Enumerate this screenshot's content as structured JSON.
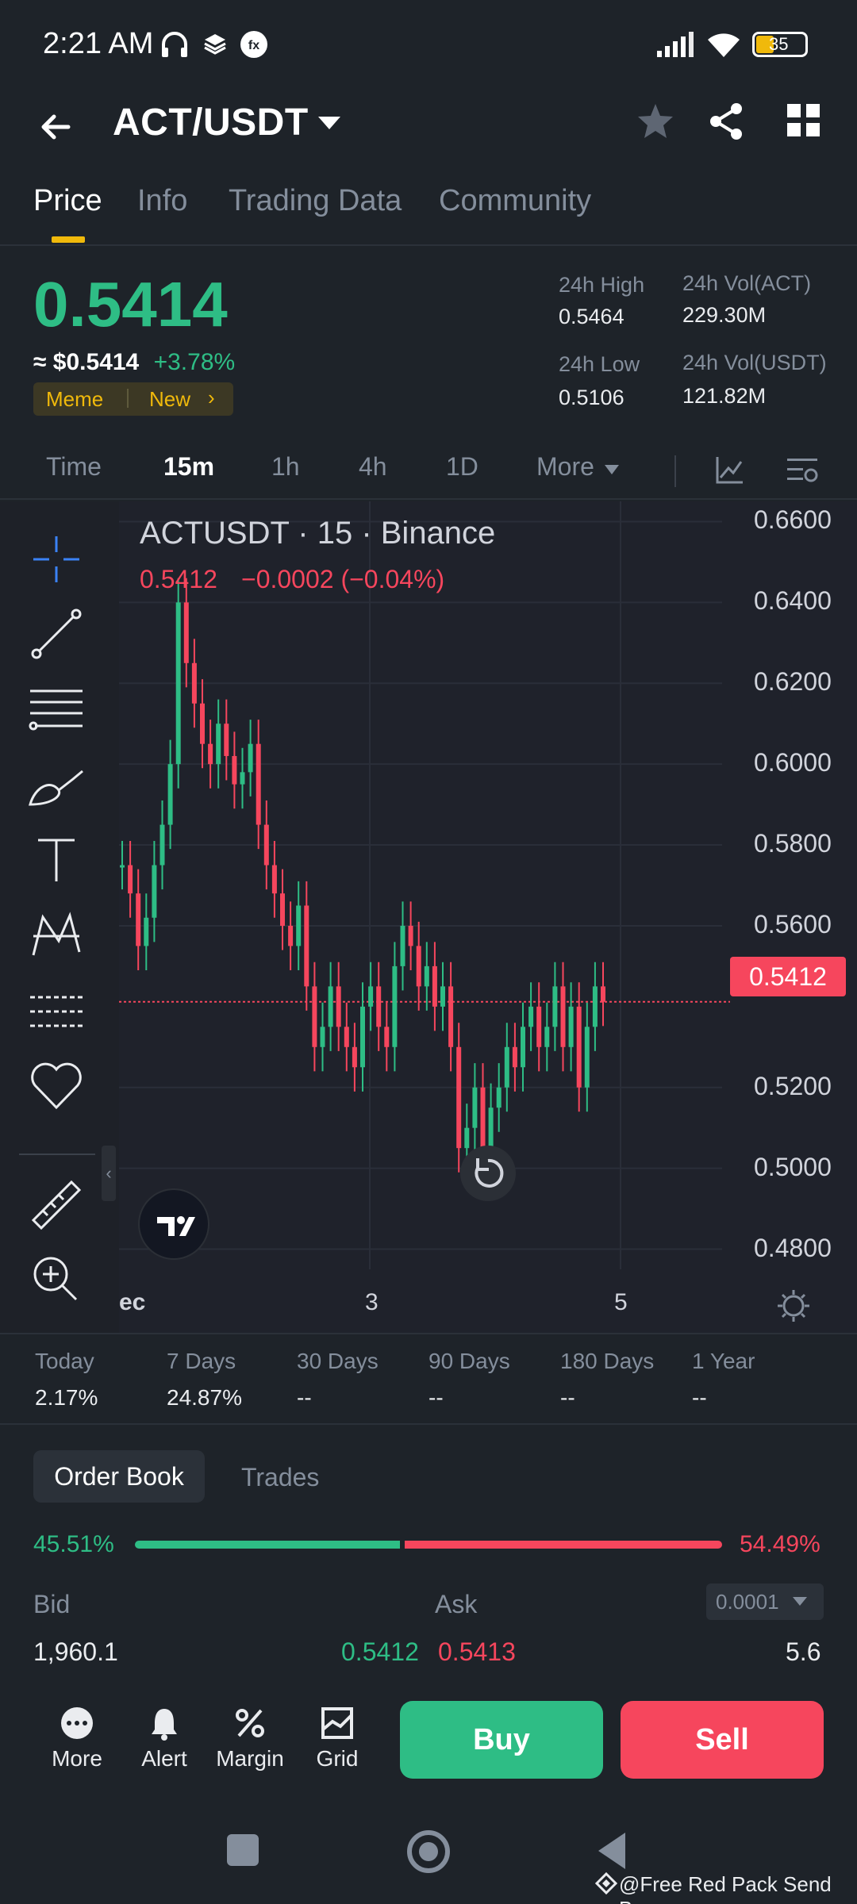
{
  "status_bar": {
    "time": "2:21 AM",
    "battery": "35"
  },
  "header": {
    "pair": "ACT/USDT"
  },
  "tabs": [
    "Price",
    "Info",
    "Trading Data",
    "Community"
  ],
  "price": {
    "last": "0.5414",
    "usd": "≈ $0.5414",
    "change": "+3.78%",
    "tags": [
      "Meme",
      "New"
    ]
  },
  "stats": {
    "high_label": "24h High",
    "high": "0.5464",
    "low_label": "24h Low",
    "low": "0.5106",
    "vol_act_label": "24h Vol(ACT)",
    "vol_act": "229.30M",
    "vol_usdt_label": "24h Vol(USDT)",
    "vol_usdt": "121.82M"
  },
  "intervals": [
    "Time",
    "15m",
    "1h",
    "4h",
    "1D",
    "More"
  ],
  "chart": {
    "legend": "ACTUSDT · 15 · Binance",
    "ohlc_value": "0.5412",
    "ohlc_change": "−0.0002 (−0.04%)",
    "current_price_label": "0.5412",
    "x_ticks": [
      "ec",
      "3",
      "5"
    ]
  },
  "chart_data": {
    "type": "line",
    "title": "ACTUSDT · 15 · Binance",
    "y_ticks": [
      "0.6600",
      "0.6400",
      "0.6200",
      "0.6000",
      "0.5800",
      "0.5600",
      "0.5200",
      "0.5000",
      "0.4800"
    ],
    "ylim": [
      0.475,
      0.665
    ],
    "x_ticks": [
      "ec",
      "3",
      "5"
    ],
    "current_price": 0.5412,
    "series": [
      {
        "values": [
          0.575,
          0.568,
          0.555,
          0.562,
          0.575,
          0.585,
          0.6,
          0.64,
          0.625,
          0.615,
          0.605,
          0.6,
          0.61,
          0.602,
          0.595,
          0.598,
          0.605,
          0.585,
          0.575,
          0.568,
          0.56,
          0.555,
          0.565,
          0.545,
          0.53,
          0.535,
          0.545,
          0.535,
          0.53,
          0.525,
          0.54,
          0.545,
          0.535,
          0.53,
          0.55,
          0.56,
          0.555,
          0.545,
          0.55,
          0.54,
          0.545,
          0.53,
          0.505,
          0.51,
          0.52,
          0.505,
          0.515,
          0.52,
          0.53,
          0.525,
          0.535,
          0.54,
          0.53,
          0.535,
          0.545,
          0.53,
          0.54,
          0.52,
          0.535,
          0.545,
          0.5412
        ]
      }
    ]
  },
  "performance": [
    {
      "label": "Today",
      "value": "2.17%"
    },
    {
      "label": "7 Days",
      "value": "24.87%"
    },
    {
      "label": "30 Days",
      "value": "--"
    },
    {
      "label": "90 Days",
      "value": "--"
    },
    {
      "label": "180 Days",
      "value": "--"
    },
    {
      "label": "1 Year",
      "value": "--"
    }
  ],
  "order_book": {
    "tab_active": "Order Book",
    "tab_other": "Trades",
    "bid_pct": "45.51%",
    "ask_pct": "54.49%",
    "bid_ratio": 0.4551,
    "bid_label": "Bid",
    "ask_label": "Ask",
    "precision": "0.0001",
    "row": {
      "bid_qty": "1,960.1",
      "bid_price": "0.5412",
      "ask_price": "0.5413",
      "ask_qty": "5.6"
    }
  },
  "bottom_bar": {
    "more": "More",
    "alert": "Alert",
    "margin": "Margin",
    "grid": "Grid",
    "buy": "Buy",
    "sell": "Sell"
  },
  "footer": {
    "watermark": "@Free Red Pack Send B..."
  },
  "colors": {
    "up": "#2ebd85",
    "down": "#f6465d",
    "accent": "#f0b90b",
    "bg": "#1e2329"
  }
}
